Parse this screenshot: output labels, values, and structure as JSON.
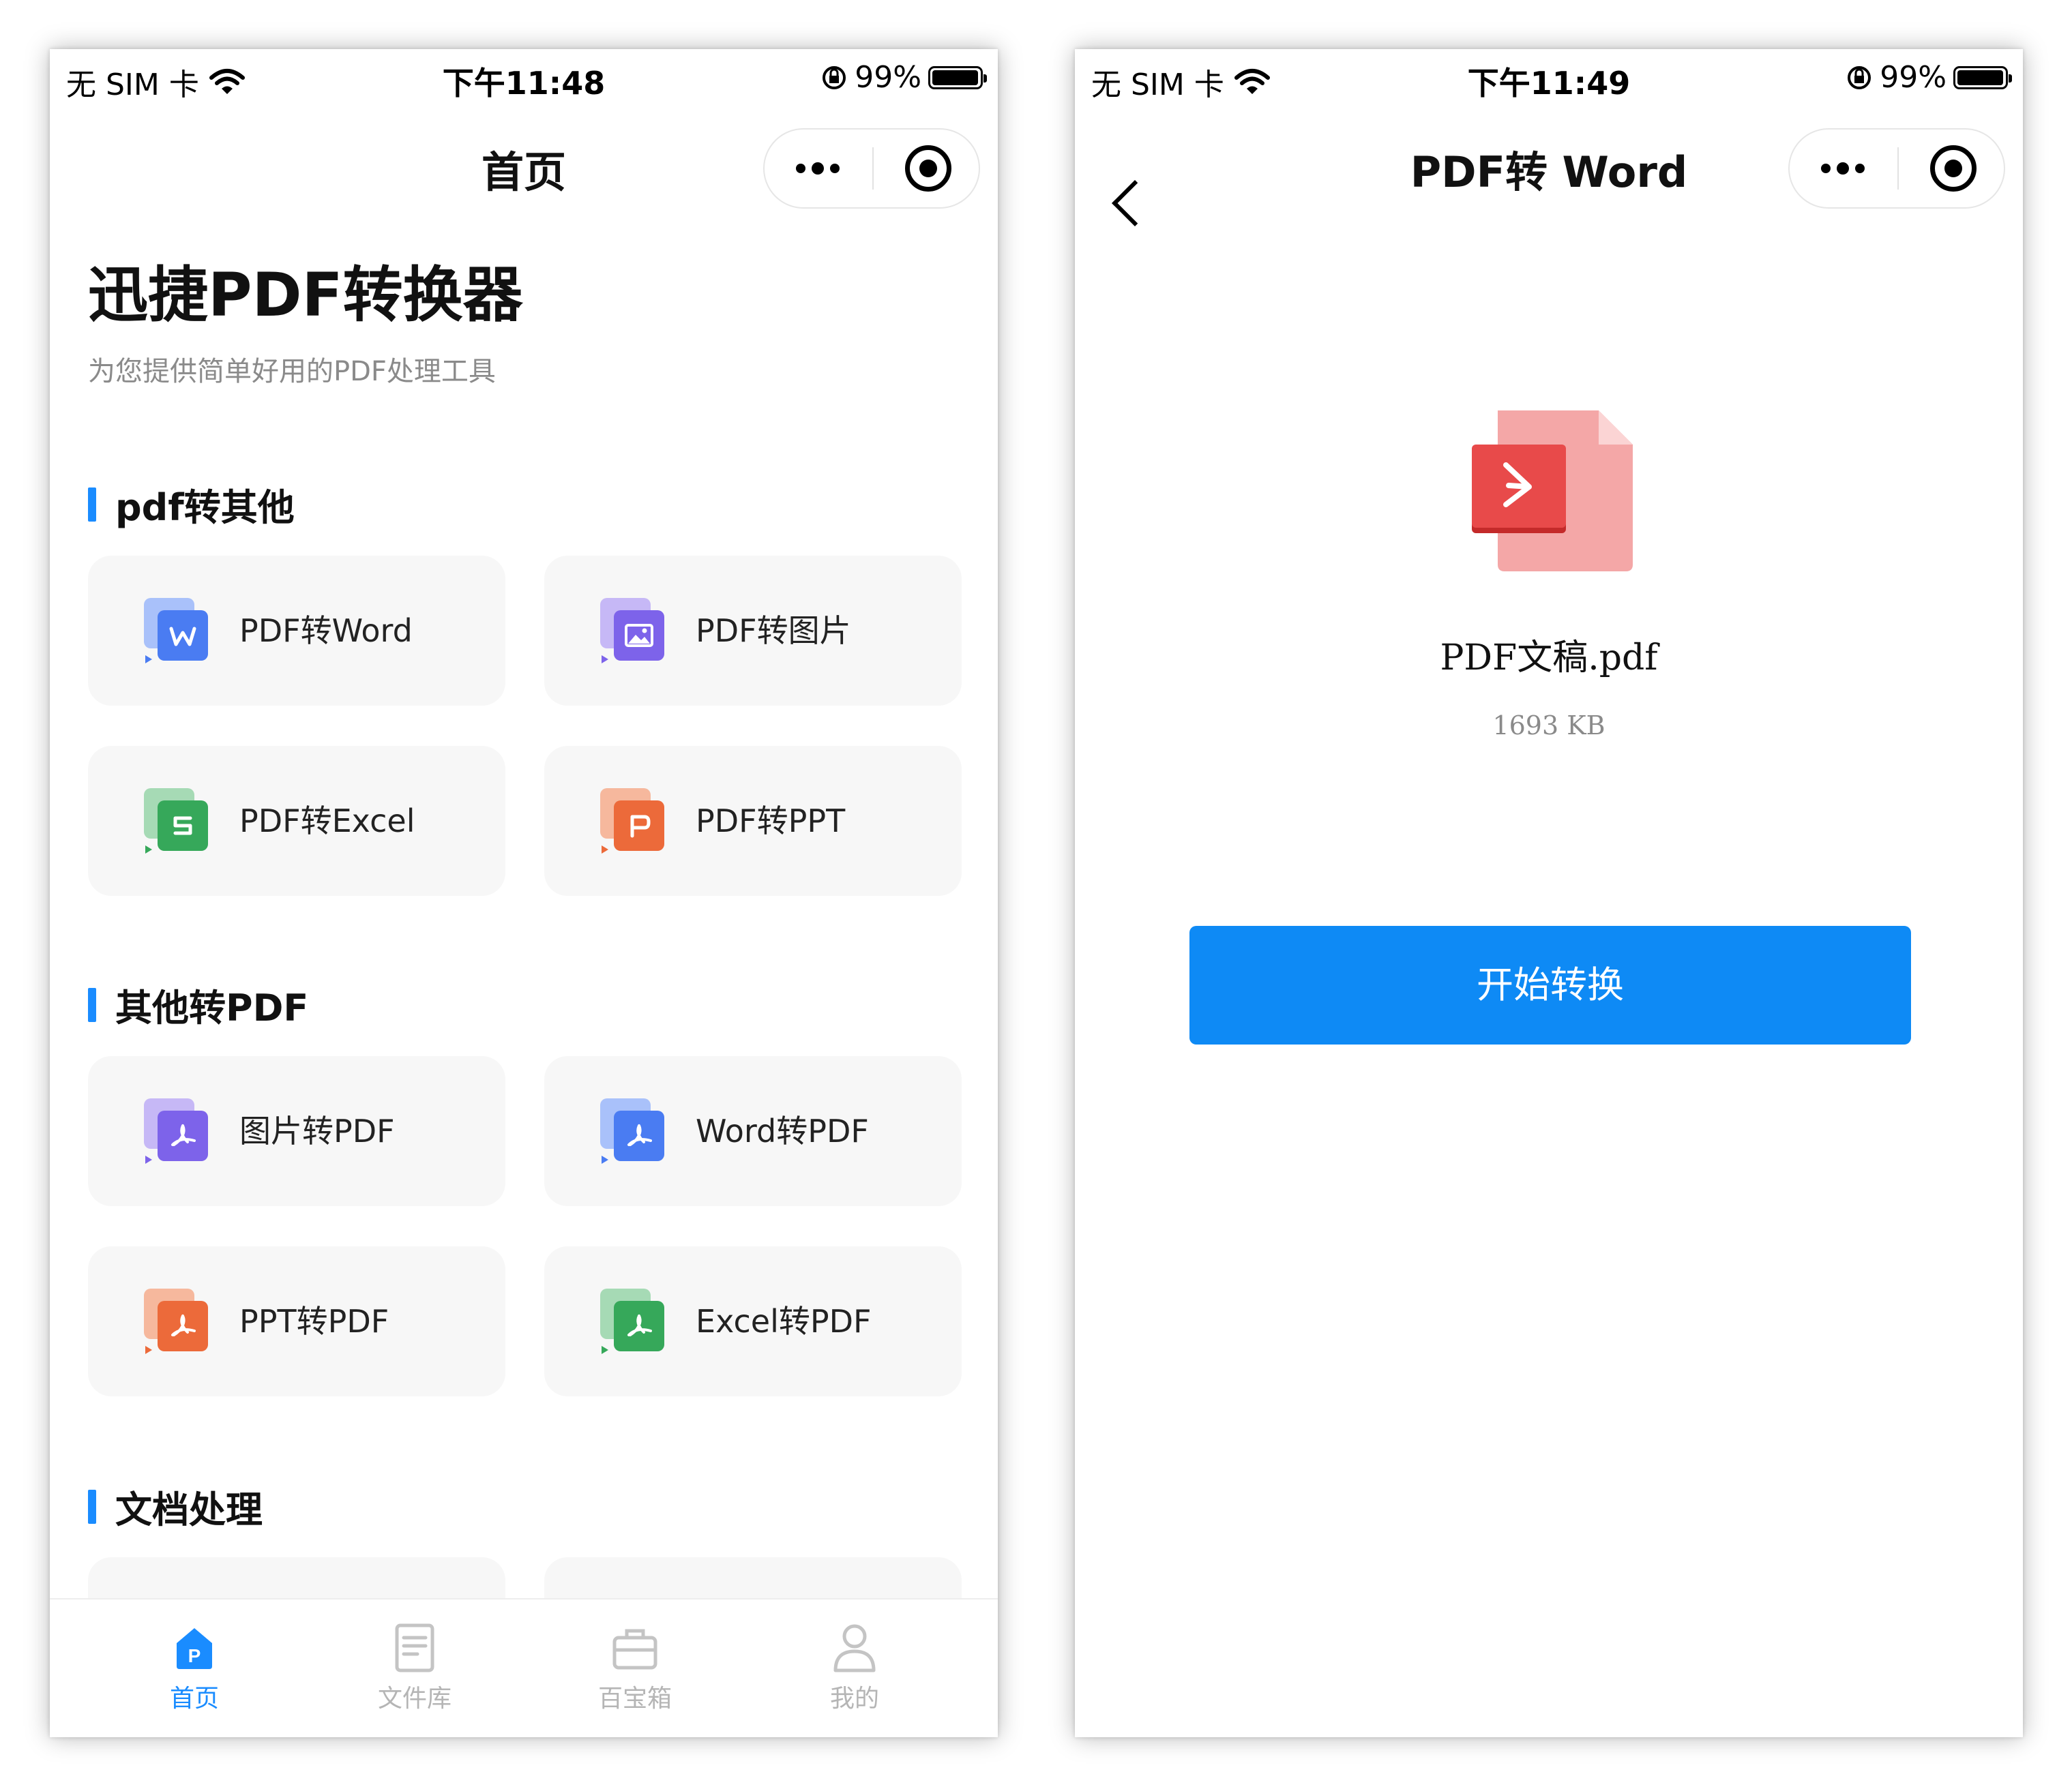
{
  "left": {
    "status": {
      "carrier": "无 SIM 卡",
      "time": "下午11:48",
      "battery": "99%"
    },
    "nav": {
      "title": "首页"
    },
    "header": {
      "title": "迅捷PDF转换器",
      "subtitle": "为您提供简单好用的PDF处理工具"
    },
    "sections": [
      {
        "title": "pdf转其他",
        "items": [
          {
            "label": "PDF转Word",
            "icon": "word-icon",
            "color": "#4a7cf2"
          },
          {
            "label": "PDF转图片",
            "icon": "image-icon",
            "color": "#7d63ea"
          },
          {
            "label": "PDF转Excel",
            "icon": "excel-icon",
            "color": "#36a85a"
          },
          {
            "label": "PDF转PPT",
            "icon": "ppt-icon",
            "color": "#ec6a3a"
          }
        ]
      },
      {
        "title": "其他转PDF",
        "items": [
          {
            "label": "图片转PDF",
            "icon": "pdf-icon",
            "color": "#7d63ea"
          },
          {
            "label": "Word转PDF",
            "icon": "pdf-icon",
            "color": "#4a7cf2"
          },
          {
            "label": "PPT转PDF",
            "icon": "pdf-icon",
            "color": "#ec6a3a"
          },
          {
            "label": "Excel转PDF",
            "icon": "pdf-icon",
            "color": "#36a85a"
          }
        ]
      },
      {
        "title": "文档处理"
      }
    ],
    "tabs": [
      {
        "label": "首页",
        "icon": "home-icon",
        "active": true
      },
      {
        "label": "文件库",
        "icon": "document-icon",
        "active": false
      },
      {
        "label": "百宝箱",
        "icon": "toolbox-icon",
        "active": false
      },
      {
        "label": "我的",
        "icon": "user-icon",
        "active": false
      }
    ]
  },
  "right": {
    "status": {
      "carrier": "无 SIM 卡",
      "time": "下午11:49",
      "battery": "99%"
    },
    "nav": {
      "title": "PDF转 Word"
    },
    "file": {
      "name": "PDF文稿.pdf",
      "size": "1693 KB"
    },
    "button": {
      "label": "开始转换"
    }
  },
  "colors": {
    "accent": "#1a8cff",
    "button": "#0e8af5",
    "card": "#f7f7f7"
  }
}
